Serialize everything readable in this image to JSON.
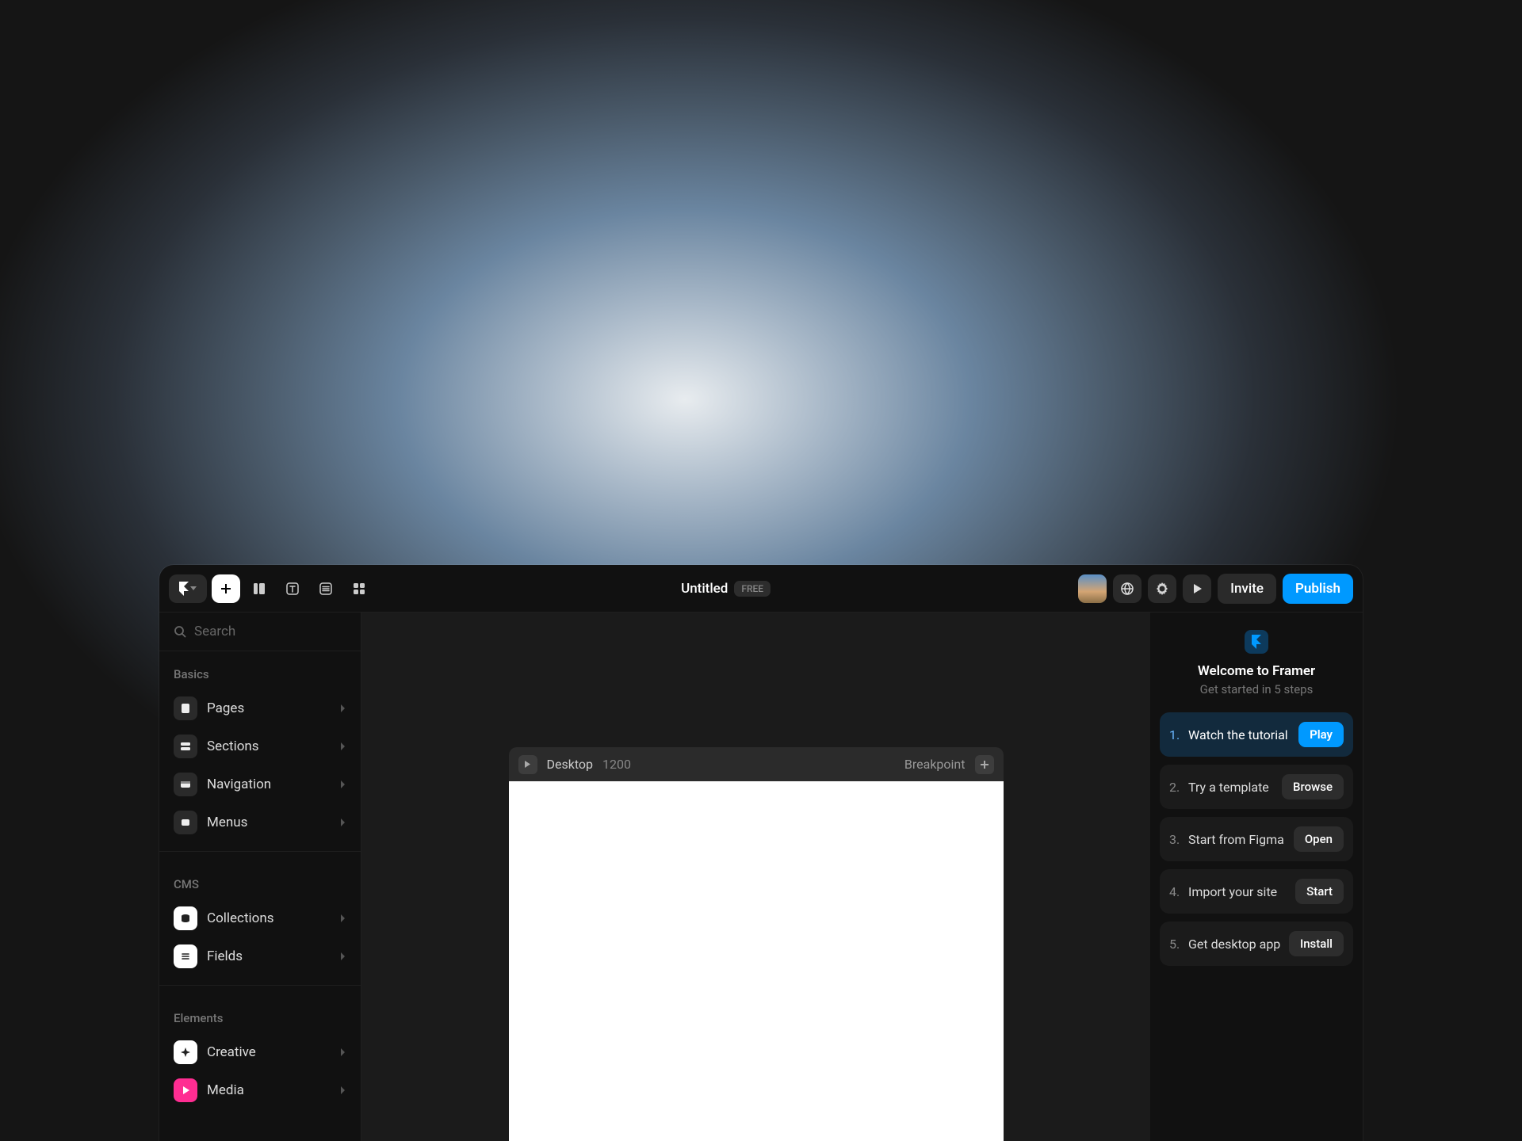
{
  "header": {
    "title": "Untitled",
    "badge": "FREE",
    "invite": "Invite",
    "publish": "Publish"
  },
  "sidebar": {
    "search_placeholder": "Search",
    "sections": {
      "basics": {
        "label": "Basics",
        "items": [
          "Pages",
          "Sections",
          "Navigation",
          "Menus"
        ]
      },
      "cms": {
        "label": "CMS",
        "items": [
          "Collections",
          "Fields"
        ]
      },
      "elements": {
        "label": "Elements",
        "items": [
          "Creative",
          "Media"
        ]
      }
    }
  },
  "canvas": {
    "device": "Desktop",
    "width": "1200",
    "breakpoint_label": "Breakpoint"
  },
  "welcome": {
    "title": "Welcome to Framer",
    "subtitle": "Get started in 5 steps",
    "steps": [
      {
        "num": "1.",
        "label": "Watch the tutorial",
        "action": "Play"
      },
      {
        "num": "2.",
        "label": "Try a template",
        "action": "Browse"
      },
      {
        "num": "3.",
        "label": "Start from Figma",
        "action": "Open"
      },
      {
        "num": "4.",
        "label": "Import your site",
        "action": "Start"
      },
      {
        "num": "5.",
        "label": "Get desktop app",
        "action": "Install"
      }
    ]
  }
}
